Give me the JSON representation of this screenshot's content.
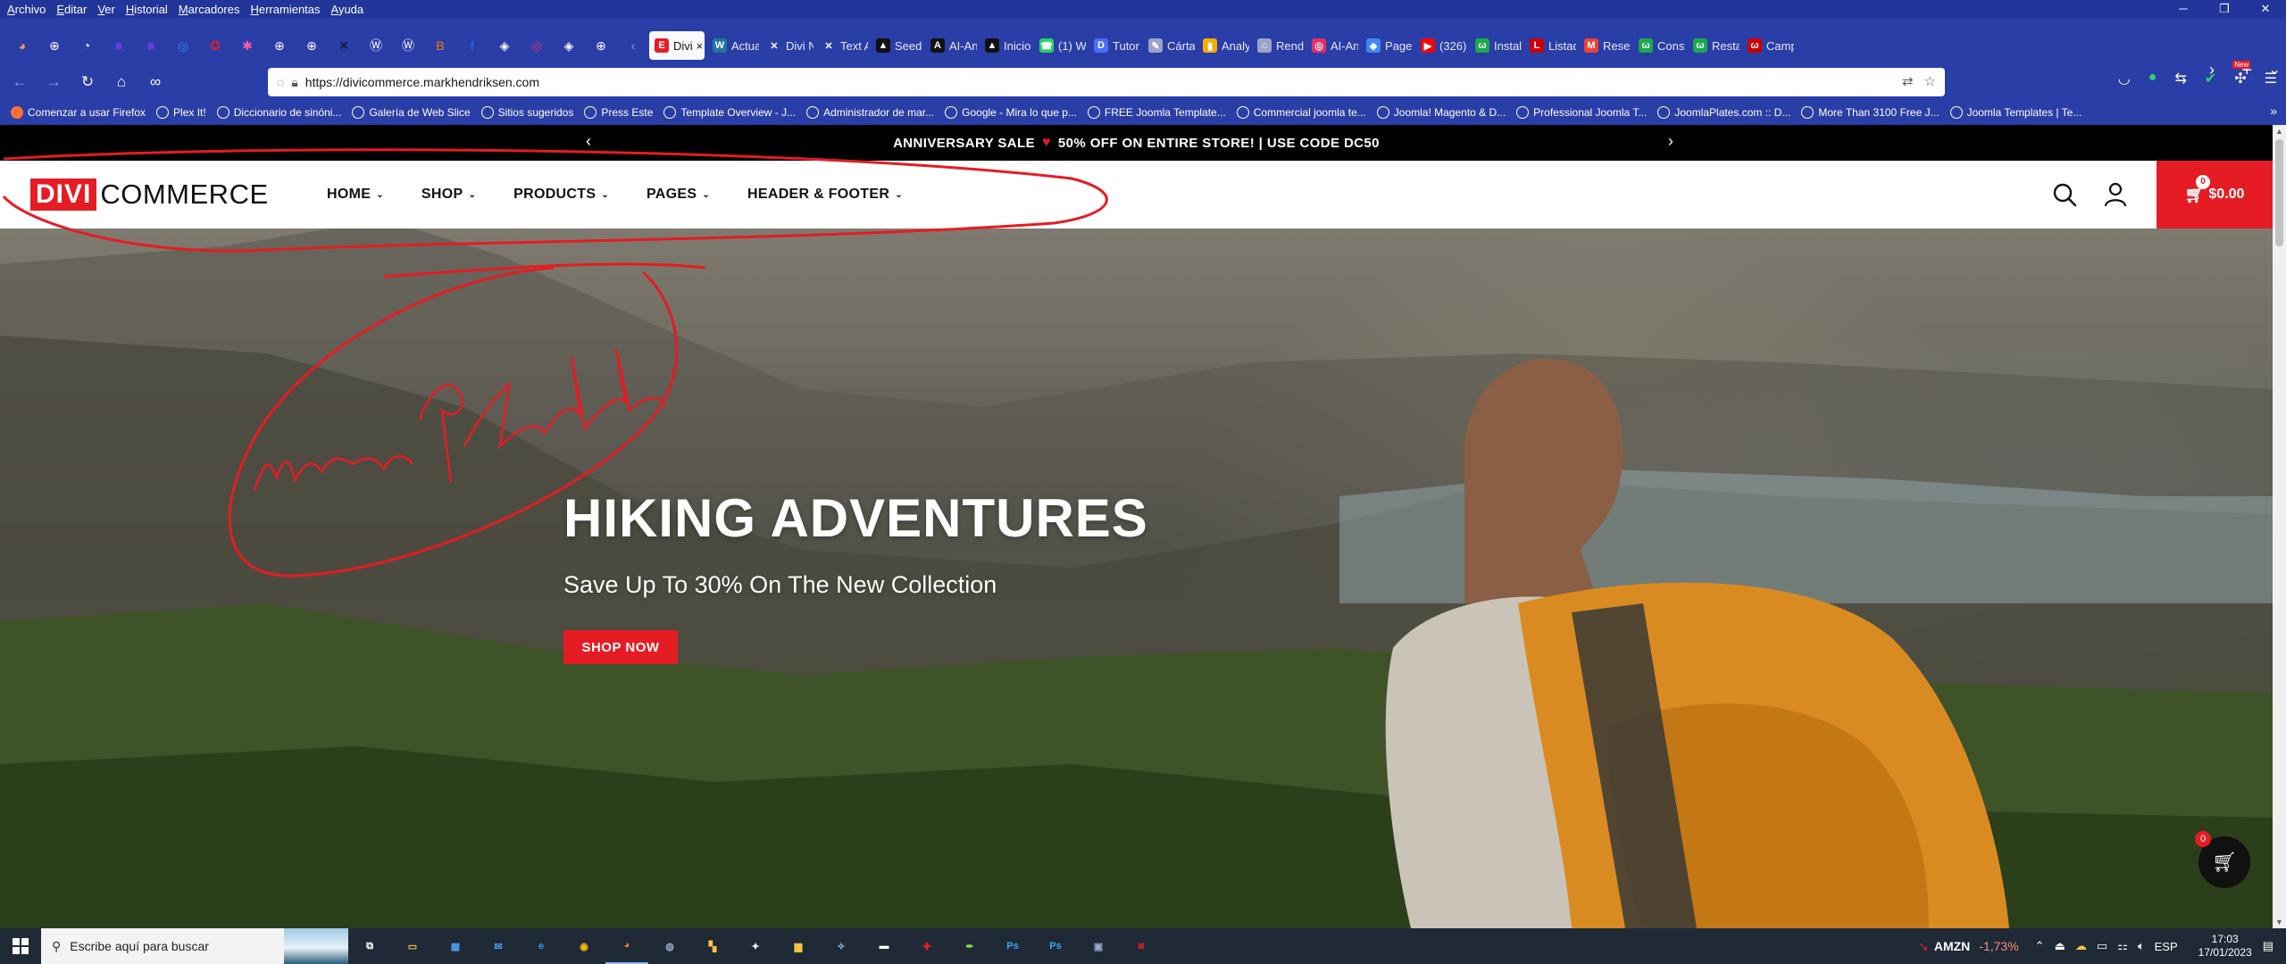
{
  "browser": {
    "menu": [
      "Archivo",
      "Editar",
      "Ver",
      "Historial",
      "Marcadores",
      "Herramientas",
      "Ayuda"
    ],
    "tabs": [
      {
        "label": "Divi",
        "icon_text": "E",
        "icon_color": "#e51c23",
        "active": true,
        "close": "×"
      },
      {
        "label": "Actua",
        "icon_text": "W",
        "icon_color": "#21759b"
      },
      {
        "label": "Divi N",
        "icon_text": "✕",
        "icon_color": "#2a3ea8"
      },
      {
        "label": "Text A",
        "icon_text": "✕",
        "icon_color": "#2a3ea8"
      },
      {
        "label": "SeedP",
        "icon_text": "▲",
        "icon_color": "#111111"
      },
      {
        "label": "AI-An",
        "icon_text": "A",
        "icon_color": "#111111"
      },
      {
        "label": "Inicio",
        "icon_text": "▲",
        "icon_color": "#111111"
      },
      {
        "label": "(1) W",
        "icon_text": "☎",
        "icon_color": "#25d366"
      },
      {
        "label": "Tutor",
        "icon_text": "D",
        "icon_color": "#4a6cf7"
      },
      {
        "label": "Cárta",
        "icon_text": "✎",
        "icon_color": "#9aa4c8"
      },
      {
        "label": "Analy",
        "icon_text": "▮",
        "icon_color": "#f9ab00"
      },
      {
        "label": "Rendi",
        "icon_text": "⌂",
        "icon_color": "#9aa4c8"
      },
      {
        "label": "AI-An",
        "icon_text": "◎",
        "icon_color": "#e1306c"
      },
      {
        "label": "PageS",
        "icon_text": "◆",
        "icon_color": "#4285f4"
      },
      {
        "label": "(326)",
        "icon_text": "▶",
        "icon_color": "#ff0000"
      },
      {
        "label": "Instal",
        "icon_text": "ω",
        "icon_color": "#1ba94c"
      },
      {
        "label": "Listad",
        "icon_text": "L",
        "icon_color": "#cc0000"
      },
      {
        "label": "Reset",
        "icon_text": "M",
        "icon_color": "#ea4335"
      },
      {
        "label": "Const",
        "icon_text": "ω",
        "icon_color": "#1ba94c"
      },
      {
        "label": "Restal",
        "icon_text": "ω",
        "icon_color": "#1ba94c"
      },
      {
        "label": "Camp",
        "icon_text": "ω",
        "icon_color": "#cc0000"
      }
    ],
    "pinned_icons": [
      "globe-icon",
      "pocket-icon",
      "purple-app-icon",
      "purple-app-icon",
      "messenger-icon",
      "game-icon",
      "star-icon",
      "globe-icon",
      "globe-icon",
      "puzzle-icon",
      "wordpress-icon",
      "wordpress-icon",
      "blogger-icon",
      "facebook-icon",
      "app-icon",
      "instagram-icon",
      "app-icon",
      "globe-icon"
    ],
    "url": "https://divicommerce.markhendriksen.com",
    "new_tab": "+",
    "bookmarks": [
      "Comenzar a usar Firefox",
      "Plex It!",
      "Diccionario de sinóni...",
      "Galería de Web Slice",
      "Sitios sugeridos",
      "Press Este",
      "Template Overview - J...",
      "Administrador de mar...",
      "Google - Mira lo que p...",
      "FREE Joomla Template...",
      "Commercial joomla te...",
      "Joomla! Magento & D...",
      "Professional Joomla T...",
      "JoomlaPlates.com :: D...",
      "More Than 3100 Free J...",
      "Joomla Templates | Te..."
    ],
    "new_badge": "New"
  },
  "site": {
    "promo": {
      "part1": "ANNIVERSARY SALE",
      "part2": "50% OFF ON ENTIRE STORE! | USE CODE DC50"
    },
    "logo": {
      "part1": "DIVI",
      "part2": "COMMERCE"
    },
    "nav": [
      "HOME",
      "SHOP",
      "PRODUCTS",
      "PAGES",
      "HEADER & FOOTER"
    ],
    "cart": {
      "count": "0",
      "total": "$0.00"
    },
    "hero": {
      "title": "HIKING ADVENTURES",
      "subtitle": "Save Up To 30% On The New Collection",
      "cta": "SHOP NOW"
    },
    "floating_cart_count": "0",
    "annotation_text": "nueva plantilla"
  },
  "taskbar": {
    "search_placeholder": "Escribe aquí para buscar",
    "apps": [
      {
        "icon": "task-view-icon",
        "glyph": "⧉",
        "color": "#ffffff"
      },
      {
        "icon": "file-explorer-icon",
        "glyph": "▭",
        "color": "#f5c542"
      },
      {
        "icon": "store-icon",
        "glyph": "▦",
        "color": "#4a9ff5"
      },
      {
        "icon": "mail-icon",
        "glyph": "✉",
        "color": "#4a9ff5"
      },
      {
        "icon": "edge-icon",
        "glyph": "e",
        "color": "#1fa3e8"
      },
      {
        "icon": "chrome-icon",
        "glyph": "◉",
        "color": "#fbbc05"
      },
      {
        "icon": "firefox-icon",
        "glyph": "◕",
        "color": "#ff7139"
      },
      {
        "icon": "app-icon",
        "glyph": "◍",
        "color": "#9aa4c8"
      },
      {
        "icon": "app-icon",
        "glyph": "▚",
        "color": "#f5c542"
      },
      {
        "icon": "app-icon",
        "glyph": "✦",
        "color": "#ffffff"
      },
      {
        "icon": "app-icon",
        "glyph": "▆",
        "color": "#f5c542"
      },
      {
        "icon": "app-icon",
        "glyph": "✧",
        "color": "#9ec9e8"
      },
      {
        "icon": "app-icon",
        "glyph": "▬",
        "color": "#ffffff"
      },
      {
        "icon": "app-icon",
        "glyph": "✚",
        "color": "#e51c23"
      },
      {
        "icon": "app-icon",
        "glyph": "✒",
        "color": "#7ed957"
      },
      {
        "icon": "photoshop-icon",
        "glyph": "Ps",
        "color": "#31a8ff"
      },
      {
        "icon": "photoshop-icon",
        "glyph": "Ps",
        "color": "#31a8ff"
      },
      {
        "icon": "app-icon",
        "glyph": "▣",
        "color": "#9aa4c8"
      },
      {
        "icon": "app-icon",
        "glyph": "◙",
        "color": "#e51c23"
      }
    ],
    "stock": {
      "symbol": "AMZN",
      "change": "-1,73%"
    },
    "lang": "ESP",
    "time": "17:03",
    "date": "17/01/2023"
  }
}
